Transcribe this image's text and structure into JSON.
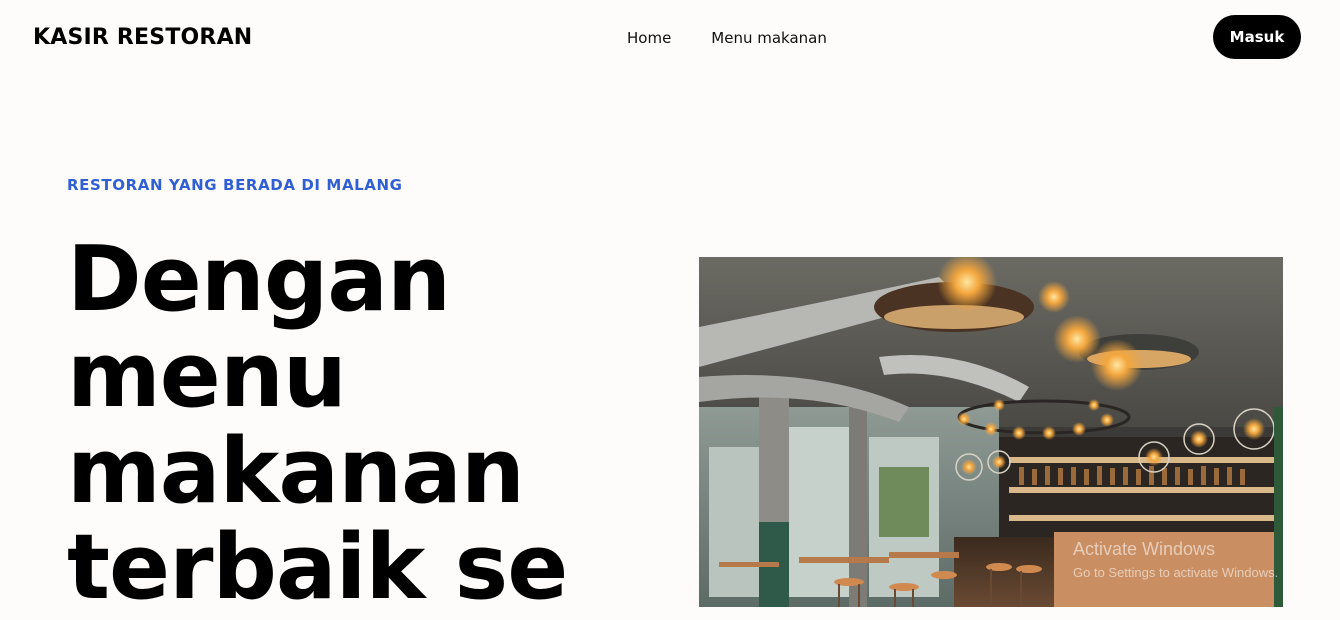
{
  "header": {
    "brand": "KASIR RESTORAN",
    "nav": [
      {
        "label": "Home"
      },
      {
        "label": "Menu makanan"
      }
    ],
    "login_label": "Masuk"
  },
  "hero": {
    "eyebrow": "RESTORAN YANG BERADA DI MALANG",
    "title": "Dengan menu makanan terbaik se",
    "image": "restaurant-interior-photo"
  },
  "system_overlay": {
    "activate_title": "Activate Windows",
    "activate_sub": "Go to Settings to activate Windows."
  },
  "colors": {
    "background": "#fdfcfb",
    "accent": "#2f5fd3",
    "button": "#000000"
  }
}
